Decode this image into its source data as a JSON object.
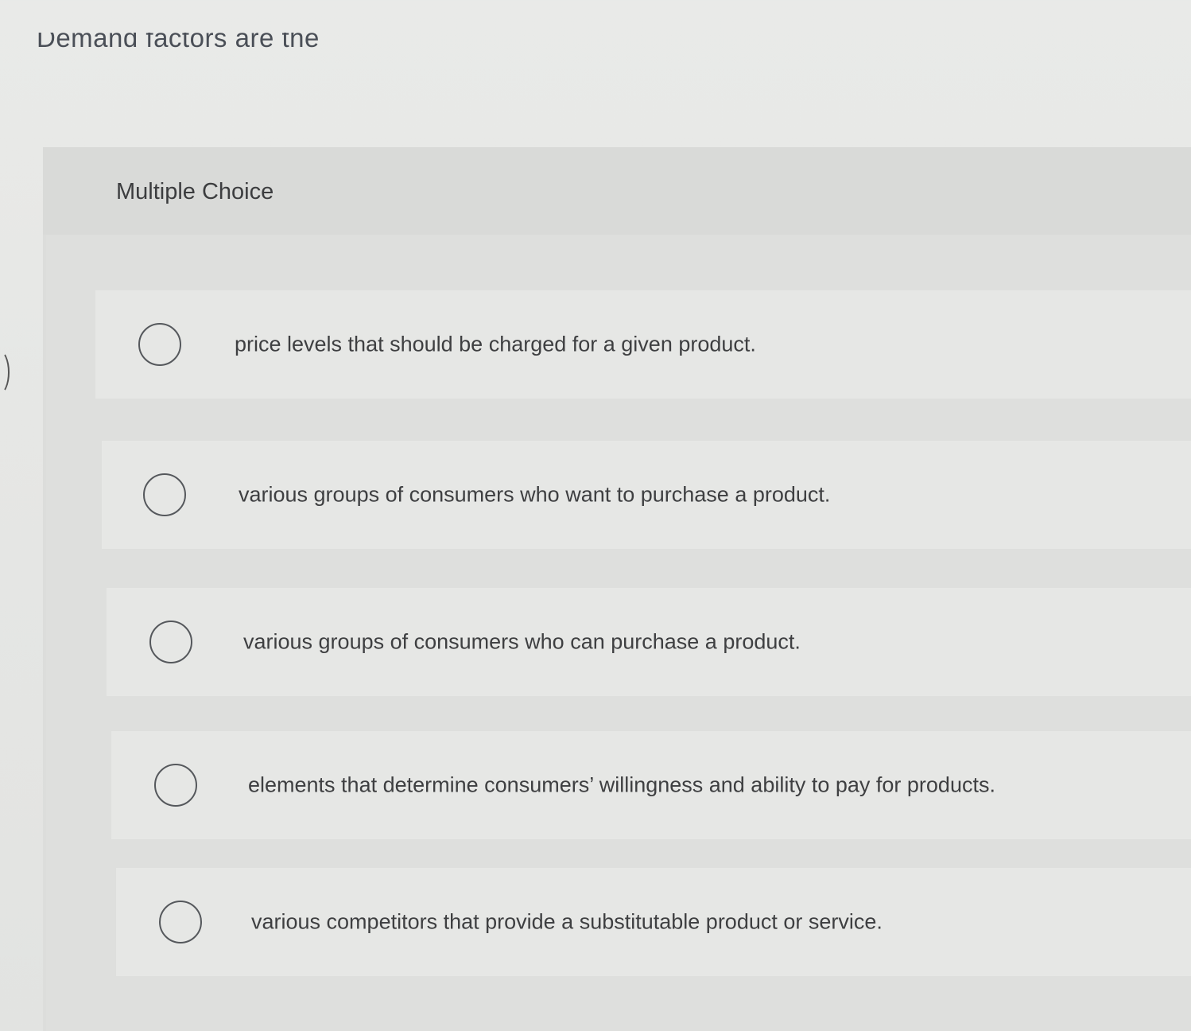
{
  "question": {
    "stem": "Demand factors are the"
  },
  "multiple_choice": {
    "title": "Multiple Choice",
    "options": [
      {
        "label": "price levels that should be charged for a given product."
      },
      {
        "label": "various groups of consumers who want to purchase a product."
      },
      {
        "label": "various groups of consumers who can purchase a product."
      },
      {
        "label": "elements that determine consumers’ willingness and ability to pay for products."
      },
      {
        "label": "various competitors that provide a substitutable product or service."
      }
    ]
  }
}
